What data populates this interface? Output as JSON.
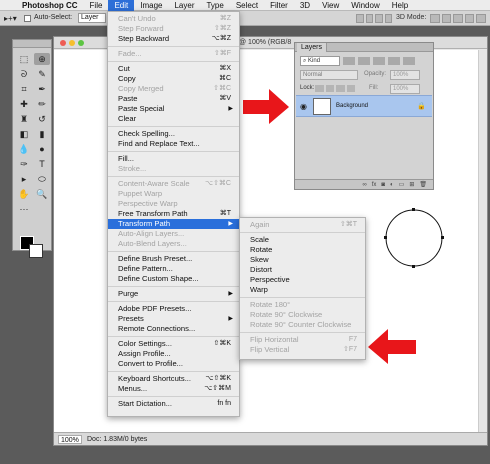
{
  "menubar": {
    "app": "Photoshop CC",
    "items": [
      "File",
      "Edit",
      "Image",
      "Layer",
      "Type",
      "Select",
      "Filter",
      "3D",
      "View",
      "Window",
      "Help"
    ],
    "active": "Edit"
  },
  "options_bar": {
    "auto_select_label": "Auto-Select:",
    "auto_select_value": "Layer",
    "mode_3d_label": "3D Mode:"
  },
  "document": {
    "title": "@ 100% (RGB/8",
    "zoom": "100%",
    "doc_info": "Doc: 1.83M/0 bytes"
  },
  "layers_panel": {
    "tab": "Layers",
    "kind": "Kind",
    "blend_mode": "Normal",
    "opacity_label": "Opacity:",
    "opacity_value": "100%",
    "lock_label": "Lock:",
    "fill_label": "Fill:",
    "fill_value": "100%",
    "layer_name": "Background",
    "footer_icons": [
      "link-icon",
      "fx-icon",
      "mask-icon",
      "adjustment-icon",
      "folder-icon",
      "new-layer-icon",
      "trash-icon"
    ]
  },
  "edit_menu": [
    {
      "label": "Can't Undo",
      "shortcut": "⌘Z",
      "disabled": true
    },
    {
      "label": "Step Forward",
      "shortcut": "⇧⌘Z",
      "disabled": true
    },
    {
      "label": "Step Backward",
      "shortcut": "⌥⌘Z"
    },
    {
      "sep": true
    },
    {
      "label": "Fade...",
      "shortcut": "⇧⌘F",
      "disabled": true
    },
    {
      "sep": true
    },
    {
      "label": "Cut",
      "shortcut": "⌘X"
    },
    {
      "label": "Copy",
      "shortcut": "⌘C"
    },
    {
      "label": "Copy Merged",
      "shortcut": "⇧⌘C",
      "disabled": true
    },
    {
      "label": "Paste",
      "shortcut": "⌘V"
    },
    {
      "label": "Paste Special",
      "submenu": true
    },
    {
      "label": "Clear"
    },
    {
      "sep": true
    },
    {
      "label": "Check Spelling..."
    },
    {
      "label": "Find and Replace Text..."
    },
    {
      "sep": true
    },
    {
      "label": "Fill..."
    },
    {
      "label": "Stroke...",
      "disabled": true
    },
    {
      "sep": true
    },
    {
      "label": "Content-Aware Scale",
      "shortcut": "⌥⇧⌘C",
      "disabled": true
    },
    {
      "label": "Puppet Warp",
      "disabled": true
    },
    {
      "label": "Perspective Warp",
      "disabled": true
    },
    {
      "label": "Free Transform Path",
      "shortcut": "⌘T"
    },
    {
      "label": "Transform Path",
      "submenu": true,
      "highlighted": true
    },
    {
      "label": "Auto-Align Layers...",
      "disabled": true
    },
    {
      "label": "Auto-Blend Layers...",
      "disabled": true
    },
    {
      "sep": true
    },
    {
      "label": "Define Brush Preset..."
    },
    {
      "label": "Define Pattern..."
    },
    {
      "label": "Define Custom Shape..."
    },
    {
      "sep": true
    },
    {
      "label": "Purge",
      "submenu": true
    },
    {
      "sep": true
    },
    {
      "label": "Adobe PDF Presets..."
    },
    {
      "label": "Presets",
      "submenu": true
    },
    {
      "label": "Remote Connections..."
    },
    {
      "sep": true
    },
    {
      "label": "Color Settings...",
      "shortcut": "⇧⌘K"
    },
    {
      "label": "Assign Profile..."
    },
    {
      "label": "Convert to Profile..."
    },
    {
      "sep": true
    },
    {
      "label": "Keyboard Shortcuts...",
      "shortcut": "⌥⇧⌘K"
    },
    {
      "label": "Menus...",
      "shortcut": "⌥⇧⌘M"
    },
    {
      "sep": true
    },
    {
      "label": "Start Dictation...",
      "shortcut": "fn fn"
    }
  ],
  "transform_submenu": [
    {
      "label": "Again",
      "shortcut": "⇧⌘T",
      "disabled": true
    },
    {
      "sep": true
    },
    {
      "label": "Scale"
    },
    {
      "label": "Rotate"
    },
    {
      "label": "Skew"
    },
    {
      "label": "Distort"
    },
    {
      "label": "Perspective"
    },
    {
      "label": "Warp"
    },
    {
      "sep": true
    },
    {
      "label": "Rotate 180°",
      "disabled": true
    },
    {
      "label": "Rotate 90° Clockwise",
      "disabled": true
    },
    {
      "label": "Rotate 90° Counter Clockwise",
      "disabled": true
    },
    {
      "sep": true
    },
    {
      "label": "Flip Horizontal",
      "shortcut": "F7",
      "disabled": true
    },
    {
      "label": "Flip Vertical",
      "shortcut": "⇧F7",
      "disabled": true
    }
  ],
  "colors": {
    "highlight": "#2a6fdb",
    "arrow": "#e8161a",
    "layer_selected": "#a9c6ee"
  }
}
